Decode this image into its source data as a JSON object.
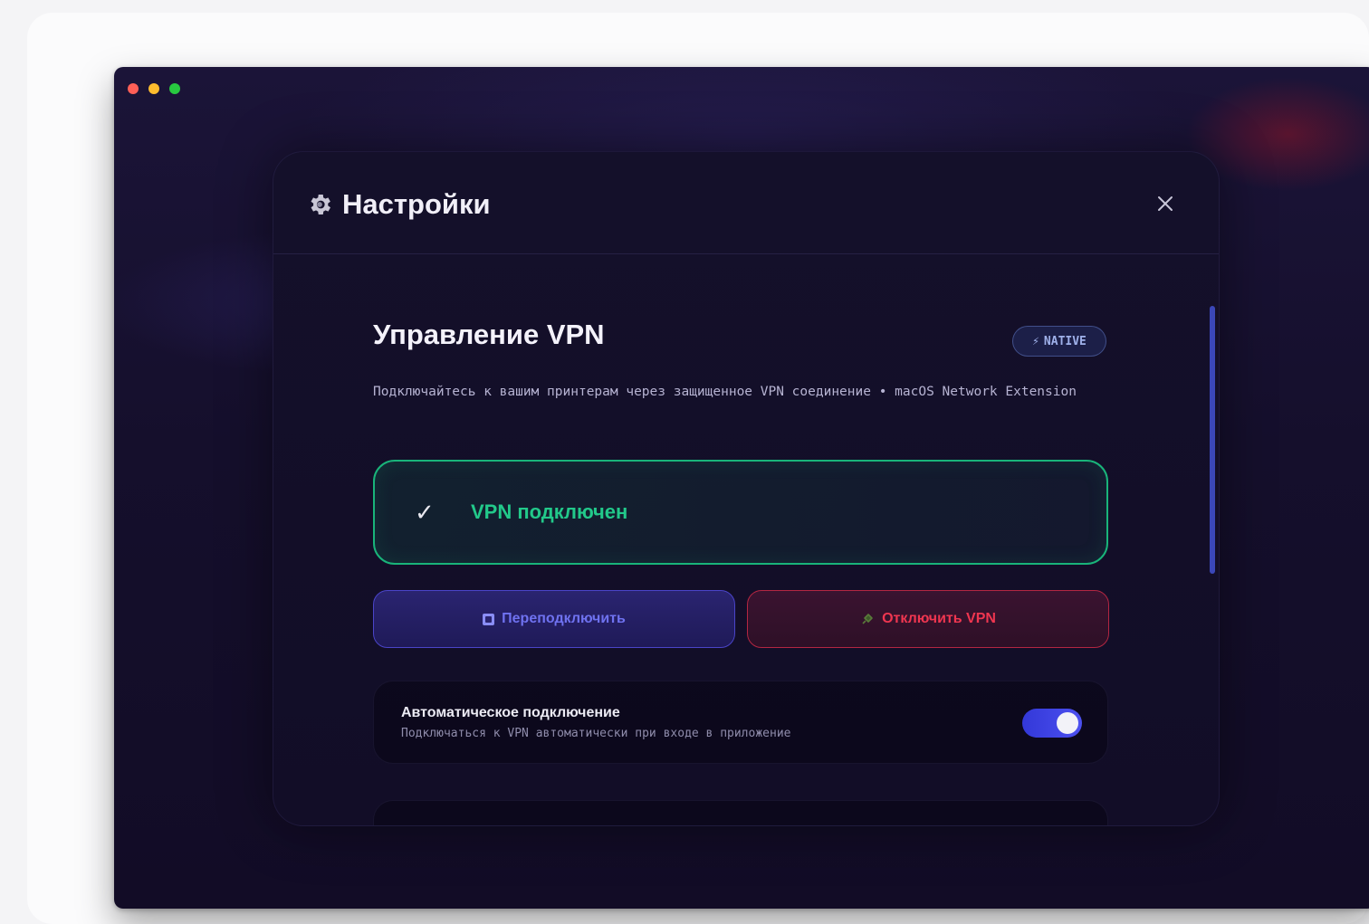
{
  "window": {
    "traffic_lights": {
      "close": "#ff5f57",
      "minimize": "#febc2e",
      "zoom": "#28c840"
    }
  },
  "modal": {
    "title": "Настройки",
    "title_icon": "gear-icon",
    "close_icon": "close-icon"
  },
  "vpn": {
    "title": "Управление VPN",
    "badge": {
      "icon": "⚡",
      "label": "NATIVE"
    },
    "description": "Подключайтесь к вашим принтерам через защищенное VPN соединение • macOS Network Extension",
    "status": {
      "icon": "✓",
      "text": "VPN подключен",
      "color": "#22c98a"
    },
    "buttons": {
      "reconnect": {
        "icon": "reconnect-icon",
        "label": "Переподключить"
      },
      "disconnect": {
        "icon": "plug-icon",
        "label": "Отключить VPN"
      }
    },
    "auto_connect": {
      "title": "Автоматическое подключение",
      "description": "Подключаться к VPN автоматически при входе в приложение",
      "enabled": true
    }
  },
  "colors": {
    "accent": "#4c50f0",
    "success": "#19b47a",
    "danger": "#ef3650"
  }
}
